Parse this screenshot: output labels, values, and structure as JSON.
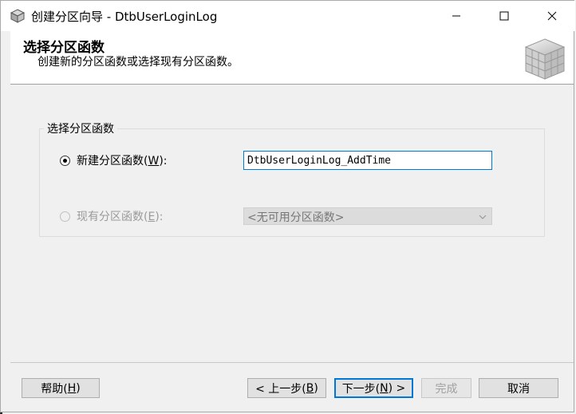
{
  "window": {
    "title": "创建分区向导 - DtbUserLoginLog",
    "controls": {
      "minimize_icon": "minimize-icon",
      "maximize_icon": "maximize-icon",
      "close_icon": "close-icon"
    }
  },
  "header": {
    "title": "选择分区函数",
    "subtitle": "创建新的分区函数或选择现有分区函数。",
    "logo_icon": "cube-grid-icon"
  },
  "group": {
    "legend": "选择分区函数",
    "new_option": {
      "label_prefix": "新建分区函数(",
      "hotkey": "W",
      "label_suffix": "):",
      "checked": true,
      "input_value": "DtbUserLoginLog_AddTime"
    },
    "existing_option": {
      "label_prefix": "现有分区函数(",
      "hotkey": "E",
      "label_suffix": "):",
      "checked": false,
      "disabled": true,
      "select_value": "<无可用分区函数>"
    }
  },
  "footer": {
    "help": {
      "prefix": "帮助(",
      "hotkey": "H",
      "suffix": ")"
    },
    "back": {
      "prefix": "< 上一步(",
      "hotkey": "B",
      "suffix": ")"
    },
    "next": {
      "prefix": "下一步(",
      "hotkey": "N",
      "suffix": ") >"
    },
    "finish": "完成",
    "cancel": "取消"
  },
  "colors": {
    "accent": "#0078d7",
    "background": "#f0f0f0",
    "header_bg": "#ffffff"
  }
}
